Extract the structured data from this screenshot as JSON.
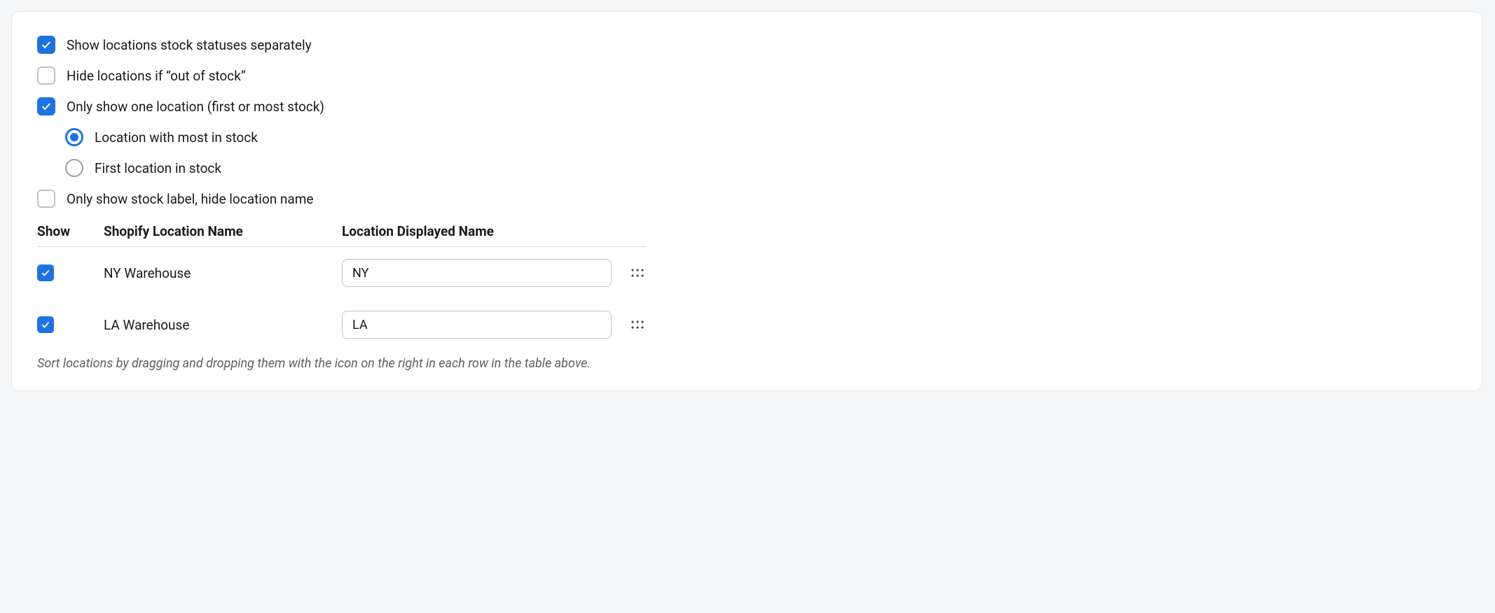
{
  "options": {
    "show_separately": {
      "label": "Show locations stock statuses separately",
      "checked": true
    },
    "hide_if_out": {
      "label": "Hide locations if “out of stock”",
      "checked": false
    },
    "only_one": {
      "label": "Only show one location (first or most stock)",
      "checked": true
    },
    "radio_most": {
      "label": "Location with most in stock",
      "selected": true
    },
    "radio_first": {
      "label": "First location in stock",
      "selected": false
    },
    "only_label": {
      "label": "Only show stock label, hide location name",
      "checked": false
    }
  },
  "table": {
    "headers": {
      "show": "Show",
      "name": "Shopify Location Name",
      "disp": "Location Displayed Name"
    },
    "rows": [
      {
        "show": true,
        "name": "NY Warehouse",
        "disp": "NY"
      },
      {
        "show": true,
        "name": "LA Warehouse",
        "disp": "LA"
      }
    ]
  },
  "hint": "Sort locations by dragging and dropping them with the icon on the right in each row in the table above."
}
